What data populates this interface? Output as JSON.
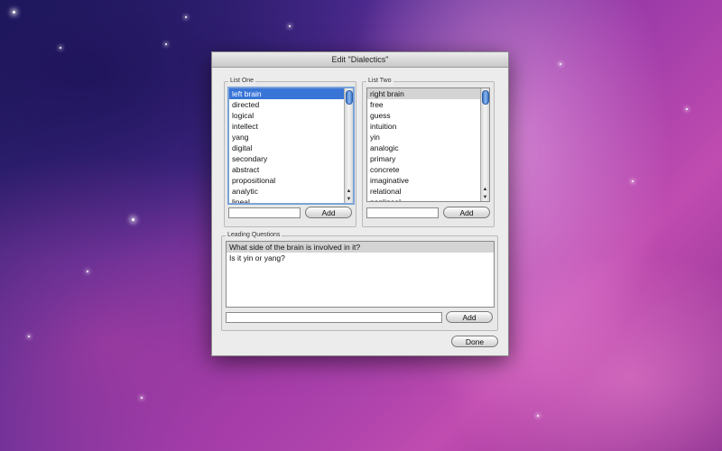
{
  "window": {
    "title": "Edit \"Dialectics\""
  },
  "list_one": {
    "label": "List One",
    "items": [
      "left brain",
      "directed",
      "logical",
      "intellect",
      "yang",
      "digital",
      "secondary",
      "abstract",
      "propositional",
      "analytic",
      "lineal"
    ],
    "selected_index": 0,
    "add_label": "Add",
    "input_value": ""
  },
  "list_two": {
    "label": "List Two",
    "items": [
      "right brain",
      "free",
      "guess",
      "intuition",
      "yin",
      "analogic",
      "primary",
      "concrete",
      "imaginative",
      "relational",
      "nonlineal"
    ],
    "selected_index": 0,
    "add_label": "Add",
    "input_value": ""
  },
  "leading_questions": {
    "label": "Leading Questions",
    "items": [
      "What side of the brain is involved in it?",
      "Is it yin or yang?"
    ],
    "selected_index": 0,
    "add_label": "Add",
    "input_value": ""
  },
  "done_label": "Done",
  "colors": {
    "selection_blue": "#3875d7",
    "selection_gray": "#d4d4d4"
  }
}
